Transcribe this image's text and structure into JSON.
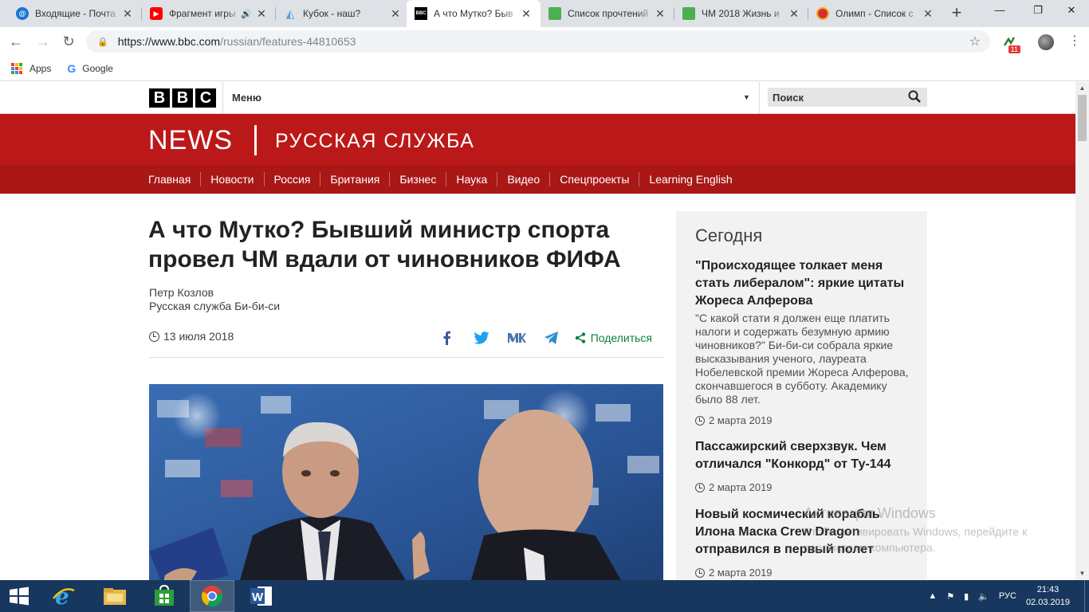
{
  "browser": {
    "tabs": [
      {
        "title": "Входящие - Почта",
        "favicon": "mail-at-icon",
        "color": "#1976d2"
      },
      {
        "title": "Фрагмент игры",
        "favicon": "youtube-icon",
        "color": "#ff0000",
        "sound": true
      },
      {
        "title": "Кубок - наш?",
        "favicon": "triangle-icon",
        "color": "#5aa0e0"
      },
      {
        "title": "А что Мутко? Быв",
        "favicon": "bbc-icon",
        "color": "#000000",
        "active": true
      },
      {
        "title": "Список прочтений",
        "favicon": "sheets-icon",
        "color": "#0f9d58"
      },
      {
        "title": "ЧМ 2018 Жизнь и",
        "favicon": "sheets-icon",
        "color": "#0f9d58"
      },
      {
        "title": "Олимп - Список с",
        "favicon": "olimp-icon",
        "color": "#d32f2f"
      }
    ],
    "url_host": "https://www.bbc.com",
    "url_path": "/russian/features-44810653",
    "extension_badge": "11",
    "bookmarks": [
      {
        "label": "Apps"
      },
      {
        "label": "Google"
      }
    ]
  },
  "masthead": {
    "bbc_letters": [
      "B",
      "B",
      "C"
    ],
    "menu_label": "Меню",
    "search_placeholder": "Поиск",
    "news_word": "NEWS",
    "service_word": "РУССКАЯ СЛУЖБА",
    "nav": [
      "Главная",
      "Новости",
      "Россия",
      "Британия",
      "Бизнес",
      "Наука",
      "Видео",
      "Спецпроекты",
      "Learning English"
    ]
  },
  "article": {
    "headline": "А что Мутко? Бывший министр спорта провел ЧМ вдали от чиновников ФИФА",
    "author_name": "Петр Козлов",
    "author_org": "Русская служба Би-би-си",
    "date": "13 июля 2018",
    "share_label": "Поделиться"
  },
  "sidebar": {
    "title": "Сегодня",
    "items": [
      {
        "headline": "\"Происходящее толкает меня стать либералом\": яркие цитаты Жореса Алферова",
        "summary": "\"С какой стати я должен еще платить налоги и содержать безумную армию чиновников?\" Би-би-си собрала яркие высказывания ученого, лауреата Нобелевской премии Жореса Алферова, скончавшегося в субботу. Академику было 88 лет.",
        "date": "2 марта 2019"
      },
      {
        "headline": "Пассажирский сверхзвук. Чем отличался \"Конкорд\" от Ту-144",
        "summary": "",
        "date": "2 марта 2019"
      },
      {
        "headline": "Новый космический корабль Илона Маска Crew Dragon отправился в первый полет",
        "summary": "",
        "date": "2 марта 2019"
      }
    ]
  },
  "watermark": {
    "line1": "Активация Windows",
    "line2": "Чтобы активировать Windows, перейдите к параметрам компьютера."
  },
  "taskbar": {
    "lang": "РУС",
    "time": "21:43",
    "date": "02.03.2019"
  },
  "colors": {
    "bbc_red": "#bb1919",
    "nav_red": "#a91717",
    "share_green": "#117f3b",
    "taskbar": "#17375e"
  }
}
